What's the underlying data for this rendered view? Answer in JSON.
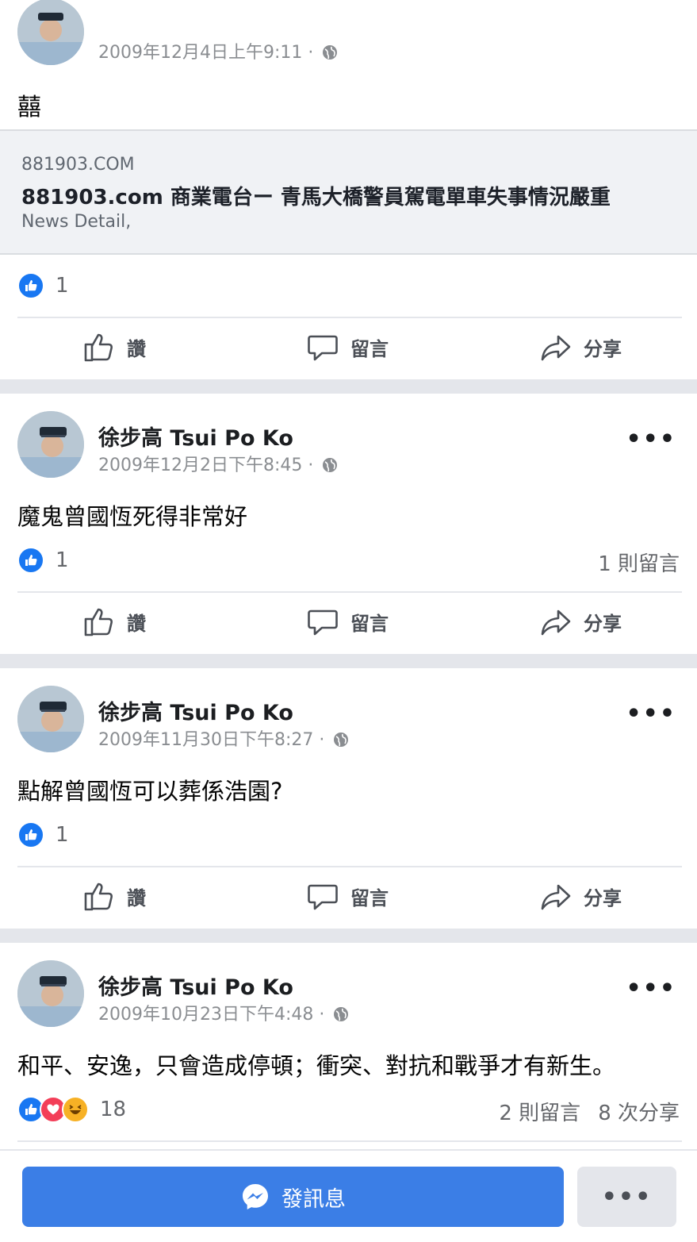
{
  "colors": {
    "accent": "#1877f2",
    "button": "#3b7ee6",
    "separator": "#e4e6eb",
    "preview_bg": "#f0f2f5"
  },
  "top_post": {
    "timestamp": "2009年12月4日上午9:11 ·",
    "text": "囍",
    "link_preview": {
      "domain": "881903.COM",
      "title": "881903.com 商業電台ー 青馬大橋警員駕電單車失事情況嚴重",
      "description": "News Detail,"
    },
    "reaction_count": "1"
  },
  "actions": {
    "like": "讚",
    "comment": "留言",
    "share": "分享"
  },
  "posts": [
    {
      "author": "徐步高 Tsui Po Ko",
      "timestamp": "2009年12月2日下午8:45 ·",
      "text": "魔鬼曾國恆死得非常好",
      "reaction_count": "1",
      "comments": "1 則留言"
    },
    {
      "author": "徐步高 Tsui Po Ko",
      "timestamp": "2009年11月30日下午8:27 ·",
      "text": "點解曾國恆可以葬係浩園?",
      "reaction_count": "1"
    },
    {
      "author": "徐步高 Tsui Po Ko",
      "timestamp": "2009年10月23日下午4:48 ·",
      "text": "和平、安逸，只會造成停頓；衝突、對抗和戰爭才有新生。",
      "reaction_count": "18",
      "comments": "2 則留言",
      "shares": "8 次分享"
    }
  ],
  "more_glyph": "•••",
  "bottom_bar": {
    "message_label": "發訊息",
    "more_label": "•••"
  },
  "icons": [
    "globe-icon",
    "like-reaction-icon",
    "love-reaction-icon",
    "haha-reaction-icon",
    "thumbs-up-icon",
    "comment-icon",
    "share-icon",
    "messenger-icon",
    "more-icon"
  ]
}
